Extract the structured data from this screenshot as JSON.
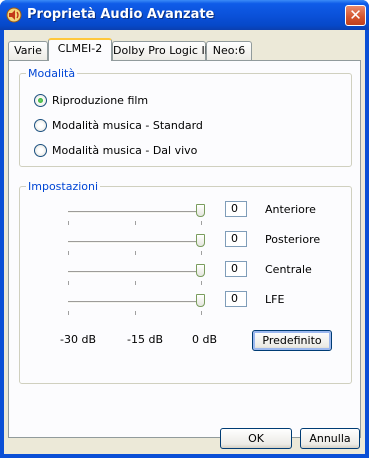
{
  "window": {
    "title": "Proprietà Audio Avanzate",
    "icon": "speaker-icon",
    "close_glyph": "✕"
  },
  "tabs": [
    {
      "label": "Varie",
      "active": false
    },
    {
      "label": "CLMEI-2",
      "active": true
    },
    {
      "label": "Dolby Pro Logic IIx",
      "active": false
    },
    {
      "label": "Neo:6",
      "active": false
    }
  ],
  "modalita": {
    "label": "Modalità",
    "options": [
      {
        "label": "Riproduzione film",
        "selected": true
      },
      {
        "label": "Modalità musica - Standard",
        "selected": false
      },
      {
        "label": "Modalità musica - Dal vivo",
        "selected": false
      }
    ]
  },
  "impostazioni": {
    "label": "Impostazioni",
    "sliders": [
      {
        "label": "Anteriore",
        "value": "0"
      },
      {
        "label": "Posteriore",
        "value": "0"
      },
      {
        "label": "Centrale",
        "value": "0"
      },
      {
        "label": "LFE",
        "value": "0"
      }
    ],
    "scale": [
      "-30 dB",
      "-15 dB",
      "0 dB"
    ],
    "default_button": "Predefinito"
  },
  "footer": {
    "ok": "OK",
    "cancel": "Annulla"
  }
}
